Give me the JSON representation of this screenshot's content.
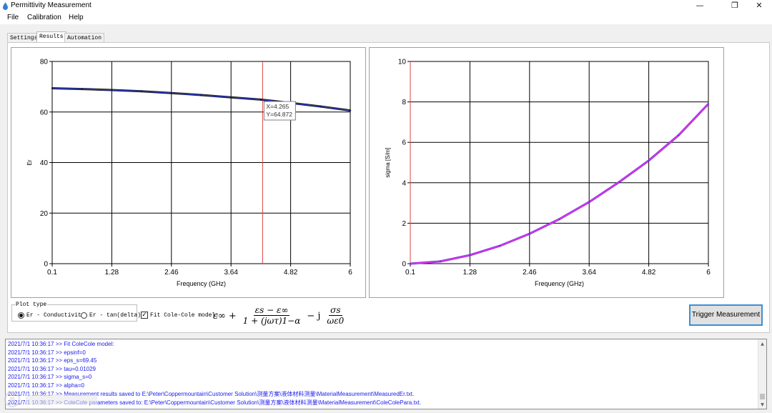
{
  "window": {
    "title": "Permittivity Measurement",
    "controls": {
      "minimize": "—",
      "restore": "❐",
      "close": "✕"
    }
  },
  "menu": {
    "items": [
      "File",
      "Calibration",
      "Help"
    ]
  },
  "tabs": [
    {
      "label": "Settings",
      "active": false
    },
    {
      "label": "Results",
      "active": true
    },
    {
      "label": "Automation",
      "active": false
    }
  ],
  "chart_data": [
    {
      "type": "line",
      "xlabel": "Frequency (GHz)",
      "ylabel": "Er",
      "xlim": [
        0.1,
        6
      ],
      "ylim": [
        0,
        80
      ],
      "xticks": [
        "0.1",
        "1.28",
        "2.46",
        "3.64",
        "4.82",
        "6"
      ],
      "yticks": [
        "0",
        "20",
        "40",
        "60",
        "80"
      ],
      "grid": true,
      "colors": {
        "measured": "#1a1a1a",
        "fit": "#2a3bd6",
        "cursor": "#e04040"
      },
      "series": [
        {
          "x": [
            0.1,
            0.69,
            1.28,
            1.87,
            2.46,
            3.05,
            3.64,
            4.23,
            4.82,
            5.41,
            6.0
          ],
          "values": [
            69.4,
            69.1,
            68.7,
            68.2,
            67.5,
            66.7,
            65.8,
            64.9,
            63.6,
            62.2,
            60.6
          ]
        }
      ],
      "cursor": {
        "x": 4.265,
        "readout": [
          "X=4.265",
          "Y=64.872"
        ]
      }
    },
    {
      "type": "line",
      "xlabel": "Frequency (GHz)",
      "ylabel": "sigma [S/m]",
      "xlim": [
        0.1,
        6
      ],
      "ylim": [
        0,
        10
      ],
      "xticks": [
        "0.1",
        "1.28",
        "2.46",
        "3.64",
        "4.82",
        "6"
      ],
      "yticks": [
        "0",
        "2",
        "4",
        "6",
        "8",
        "10"
      ],
      "grid": true,
      "colors": {
        "measured": "#7a2fd0",
        "fit": "#ff33ff",
        "cursor": "#e04040"
      },
      "series": [
        {
          "x": [
            0.1,
            0.69,
            1.28,
            1.87,
            2.46,
            3.05,
            3.64,
            4.23,
            4.82,
            5.41,
            6.0
          ],
          "values": [
            0.0,
            0.11,
            0.42,
            0.88,
            1.48,
            2.2,
            3.05,
            4.03,
            5.1,
            6.35,
            7.9
          ]
        }
      ],
      "cursor": {
        "x": 0.1
      }
    }
  ],
  "controls": {
    "plot_type_label": "Plot type",
    "options": [
      {
        "label": "Er - Conductivity",
        "selected": true
      },
      {
        "label": "Er - tan(delta)",
        "selected": false
      }
    ],
    "fit_checkbox_label": "Fit Cole-Cole model:",
    "fit_checked": true,
    "trigger_label": "Trigger Measurement"
  },
  "formula": {
    "eps_inf": "ε∞",
    "plus": "+",
    "num1": "εs − ε∞",
    "den1": "1 + (jωτ)1−α",
    "minus_j": "− j",
    "num2": "σs",
    "den2": "ωε0"
  },
  "log": [
    "2021/7/1 10:36:17 >> Fit ColeCole model:",
    "2021/7/1 10:36:17 >> epsinf=0",
    "2021/7/1 10:36:17 >> eps_s=69.45",
    "2021/7/1 10:36:17 >> tau=0.01029",
    "2021/7/1 10:36:17 >> sigma_s=0",
    "2021/7/1 10:36:17 >> alpha=0",
    "2021/7/1 10:36:17 >> Measurement results saved to E:\\Peter\\Coppermountain\\Customer Solution\\测量方案\\液体材料测量\\MaterialMeasurement\\MeasuredEr.txt.",
    "2021/7/1 10:36:17 >> ColeCole parameters saved to: E:\\Peter\\Coppermountain\\Customer Solution\\测量方案\\液体材料测量\\MaterialMeasurement\\ColeColePara.txt."
  ]
}
